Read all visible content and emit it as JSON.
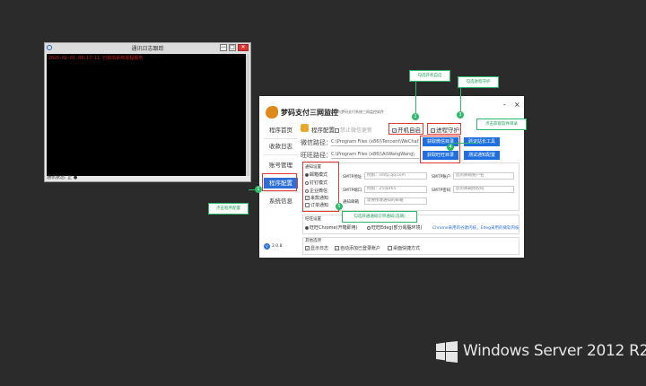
{
  "terminal": {
    "title": "通讯日志跟踪",
    "line1": "2020-02-01 08:17:11 已启动系统进程服务",
    "status": "通讯状态: 正 ●",
    "min": "—",
    "max": "□",
    "close": "✕"
  },
  "app": {
    "name": "梦码支付三网监控",
    "subtitle": "本软件为梦码支付系统三网监控软件",
    "minimize": "-",
    "close": "×",
    "nav": [
      "程序首页",
      "收款日志",
      "账号管理",
      "程序配置",
      "系统信息"
    ],
    "version": "2.0.8",
    "version_badge": "V",
    "section_title": "程序配置",
    "options": {
      "disable_wechat_update": "禁止微信更新",
      "autostart": "开机自启",
      "daemon": "进程守护"
    },
    "wechat_path_label": "微信路径：",
    "wechat_path": "C:\\Program Files (x86)\\Tencent\\WeChat\\",
    "aliww_path_label": "旺旺路径：",
    "aliww_path": "C:\\Program Files (x86)\\AliWangWang\\",
    "buttons": {
      "get_wechat_dir": "获取微信目录",
      "verify_tool": "验证站长工具",
      "get_ww_dir": "获取旺旺目录",
      "test_notify": "测试通知配置"
    },
    "notify": {
      "title": "通知设置",
      "mode_email": "邮箱模式",
      "mode_dingtalk": "钉钉模式",
      "mode_wework": "企业微信",
      "chk_pay": "来款通知",
      "chk_order": "订单通知",
      "smtp_addr_label": "SMTP地址",
      "smtp_addr": "例如：smtp.qq.com",
      "smtp_account_label": "SMTP账户",
      "smtp_account": "您的邮箱账户名",
      "smtp_port_label": "SMTP端口",
      "smtp_port": "例如：25或465",
      "smtp_pass_label": "SMTP密码",
      "smtp_pass": "您的邮箱授权码",
      "recv_label": "通知邮箱",
      "recv": "需要接收通知的邮箱"
    },
    "ww": {
      "title": "旺旺设置",
      "opt_chrome": "旺旺Chrome(开箱即用)",
      "opt_edge": "旺旺Edeg(部分電腦环境)",
      "hint": "Chrome采用的谷歌内核，Edeg采用的微软内核"
    },
    "other": {
      "title": "其他选项",
      "show_log": "显示日志",
      "auto_add": "自动添加已登录账户",
      "desktop_shortcut": "桌面快捷方式"
    }
  },
  "annotations": {
    "autostart_tag": "勾选开机自启",
    "daemon_tag": "勾选进程守护",
    "dir_tag": "点击获取软件目录",
    "config_tag": "点击程序配置",
    "notify_tag": "勾选开通通知订单通知(选填)",
    "n1": "1",
    "n2": "2",
    "n3": "3",
    "n4": "4",
    "n5": "5"
  },
  "watermark": {
    "text": "Windows Server 2012 R2"
  },
  "colors": {
    "desktop": "#2b2b2b",
    "accent_blue": "#1f6fe0",
    "annotation_green": "#2db86a",
    "annotation_red": "#e03b3b"
  }
}
